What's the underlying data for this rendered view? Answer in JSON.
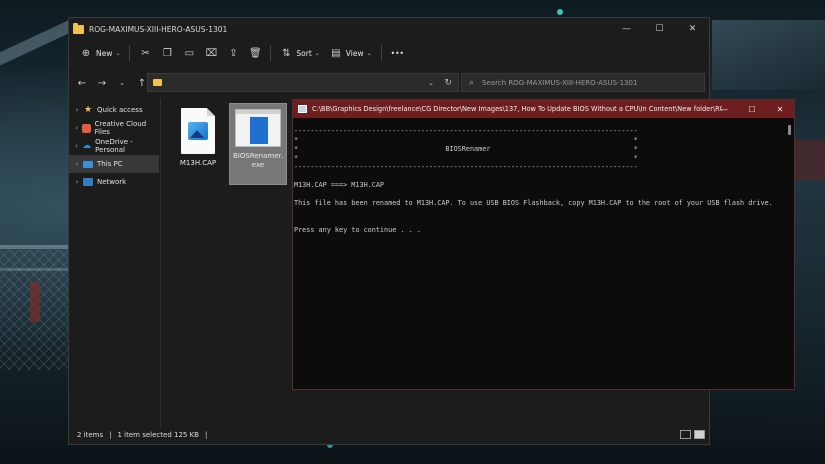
{
  "explorer": {
    "title": "ROG-MAXIMUS-XIII-HERO-ASUS-1301",
    "window_controls": {
      "minimize": "—",
      "maximize": "☐",
      "close": "✕"
    },
    "toolbar": {
      "new_label": "New",
      "sort_label": "Sort",
      "view_label": "View",
      "more_label": "•••"
    },
    "address": {
      "path": ""
    },
    "search": {
      "placeholder": "Search ROG-MAXIMUS-XIII-HERO-ASUS-1301"
    },
    "sidebar": {
      "items": [
        {
          "label": "Quick access",
          "icon": "star-icon"
        },
        {
          "label": "Creative Cloud Files",
          "icon": "creative-cloud-icon"
        },
        {
          "label": "OneDrive - Personal",
          "icon": "cloud-icon"
        },
        {
          "label": "This PC",
          "icon": "computer-icon",
          "selected": true
        },
        {
          "label": "Network",
          "icon": "network-icon"
        }
      ]
    },
    "files": [
      {
        "name": "M13H.CAP",
        "type": "image-file"
      },
      {
        "name": "BIOSRenamer.exe",
        "type": "executable",
        "selected": true
      }
    ],
    "status": {
      "item_count": "2 items",
      "selection": "1 item selected  125 KB"
    }
  },
  "console": {
    "title": "C:\\BB\\Graphics Design\\freelance\\CG Director\\New Images\\137, How To Update BIOS Without a CPU\\In Content\\New folder\\ROG-M...",
    "window_controls": {
      "minimize": "—",
      "maximize": "☐",
      "close": "✕"
    },
    "lines": [
      "------------------------------------------------------------------------------------",
      "*                                                                                  *",
      "*                                    BIOSRenamer                                   *",
      "*                                                                                  *",
      "------------------------------------------------------------------------------------",
      "",
      "M13H.CAP ===> M13H.CAP",
      "",
      "This file has been renamed to M13H.CAP. To use USB BIOS Flashback, copy M13H.CAP to the root of your USB flash drive.",
      "",
      "",
      "Press any key to continue . . ."
    ]
  },
  "colors": {
    "console_titlebar": "#6e1e1e",
    "explorer_bg": "#1c1c1c",
    "selection": "#777777"
  }
}
